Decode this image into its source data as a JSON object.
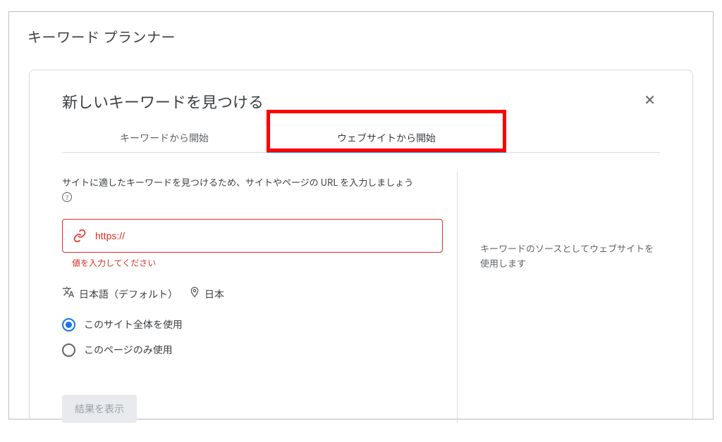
{
  "page": {
    "title": "キーワード プランナー"
  },
  "card": {
    "title": "新しいキーワードを見つける",
    "close_label": "✕"
  },
  "tabs": {
    "items": [
      {
        "label": "キーワードから開始",
        "active": false
      },
      {
        "label": "ウェブサイトから開始",
        "active": true
      }
    ]
  },
  "left": {
    "instruction": "サイトに適したキーワードを見つけるため、サイトやページの URL を入力しましょう",
    "help_glyph": "?",
    "url_placeholder": "https://",
    "url_value": "",
    "error": "値を入力してください",
    "language": "日本語（デフォルト）",
    "location": "日本",
    "radios": [
      {
        "label": "このサイト全体を使用",
        "selected": true
      },
      {
        "label": "このページのみ使用",
        "selected": false
      }
    ],
    "submit_label": "結果を表示"
  },
  "right": {
    "note": "キーワードのソースとしてウェブサイトを使用します"
  },
  "colors": {
    "error": "#d93025",
    "primary": "#1a73e8",
    "highlight": "#ff0000"
  }
}
